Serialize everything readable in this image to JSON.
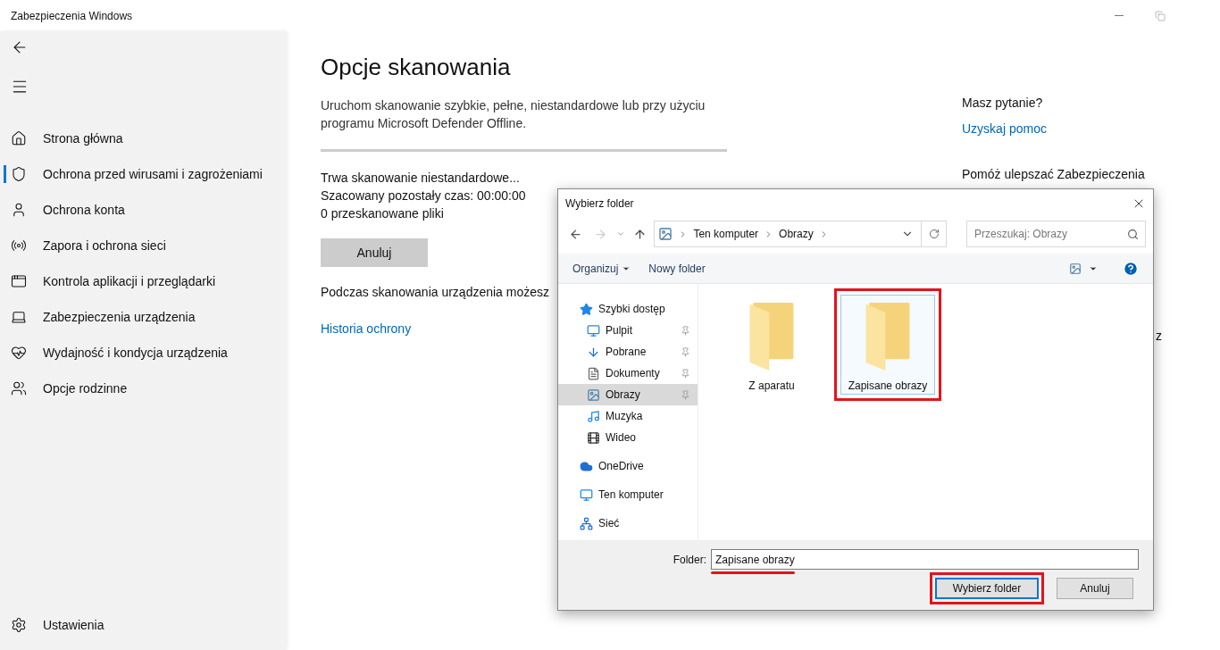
{
  "window": {
    "title": "Zabezpieczenia Windows"
  },
  "sidebar": {
    "items": [
      {
        "label": "Strona główna",
        "selected": false
      },
      {
        "label": "Ochrona przed wirusami i zagrożeniami",
        "selected": true
      },
      {
        "label": "Ochrona konta",
        "selected": false
      },
      {
        "label": "Zapora i ochrona sieci",
        "selected": false
      },
      {
        "label": "Kontrola aplikacji i przeglądarki",
        "selected": false
      },
      {
        "label": "Zabezpieczenia urządzenia",
        "selected": false
      },
      {
        "label": "Wydajność i kondycja urządzenia",
        "selected": false
      },
      {
        "label": "Opcje rodzinne",
        "selected": false
      }
    ],
    "footer": {
      "label": "Ustawienia"
    }
  },
  "main": {
    "title": "Opcje skanowania",
    "description": "Uruchom skanowanie szybkie, pełne, niestandardowe lub przy użyciu programu Microsoft Defender Offline.",
    "status_lines": [
      "Trwa skanowanie niestandardowe...",
      "Szacowany pozostały czas: 00:00:00",
      "0 przeskanowane pliki"
    ],
    "cancel_button": "Anuluj",
    "note": "Podczas skanowania urządzenia możesz",
    "link": "Historia ochrony"
  },
  "aside": {
    "question": "Masz pytanie?",
    "help_link": "Uzyskaj pomoc",
    "improve_heading": "Pomóż ulepszać Zabezpieczenia",
    "fragment": "z"
  },
  "dialog": {
    "title": "Wybierz folder",
    "breadcrumb": [
      "Ten komputer",
      "Obrazy"
    ],
    "search_placeholder": "Przeszukaj: Obrazy",
    "organize": "Organizuj",
    "new_folder": "Nowy folder",
    "nav": [
      {
        "label": "Szybki dostęp",
        "selected": false,
        "pinned": false,
        "children": [
          {
            "label": "Pulpit",
            "selected": false,
            "pinned": true
          },
          {
            "label": "Pobrane",
            "selected": false,
            "pinned": true
          },
          {
            "label": "Dokumenty",
            "selected": false,
            "pinned": true
          },
          {
            "label": "Obrazy",
            "selected": true,
            "pinned": true
          },
          {
            "label": "Muzyka",
            "selected": false,
            "pinned": false
          },
          {
            "label": "Wideo",
            "selected": false,
            "pinned": false
          }
        ]
      },
      {
        "label": "OneDrive",
        "selected": false,
        "pinned": false
      },
      {
        "label": "Ten komputer",
        "selected": false,
        "pinned": false
      },
      {
        "label": "Sieć",
        "selected": false,
        "pinned": false
      }
    ],
    "folders": [
      {
        "name": "Z aparatu",
        "selected": false,
        "highlighted": false
      },
      {
        "name": "Zapisane obrazy",
        "selected": true,
        "highlighted": true
      }
    ],
    "folder_label": "Folder:",
    "folder_value": "Zapisane obrazy",
    "folder_value_underlined": true,
    "buttons": [
      {
        "label": "Wybierz folder",
        "default": true,
        "highlighted": true
      },
      {
        "label": "Anuluj",
        "default": false,
        "highlighted": false
      }
    ]
  }
}
